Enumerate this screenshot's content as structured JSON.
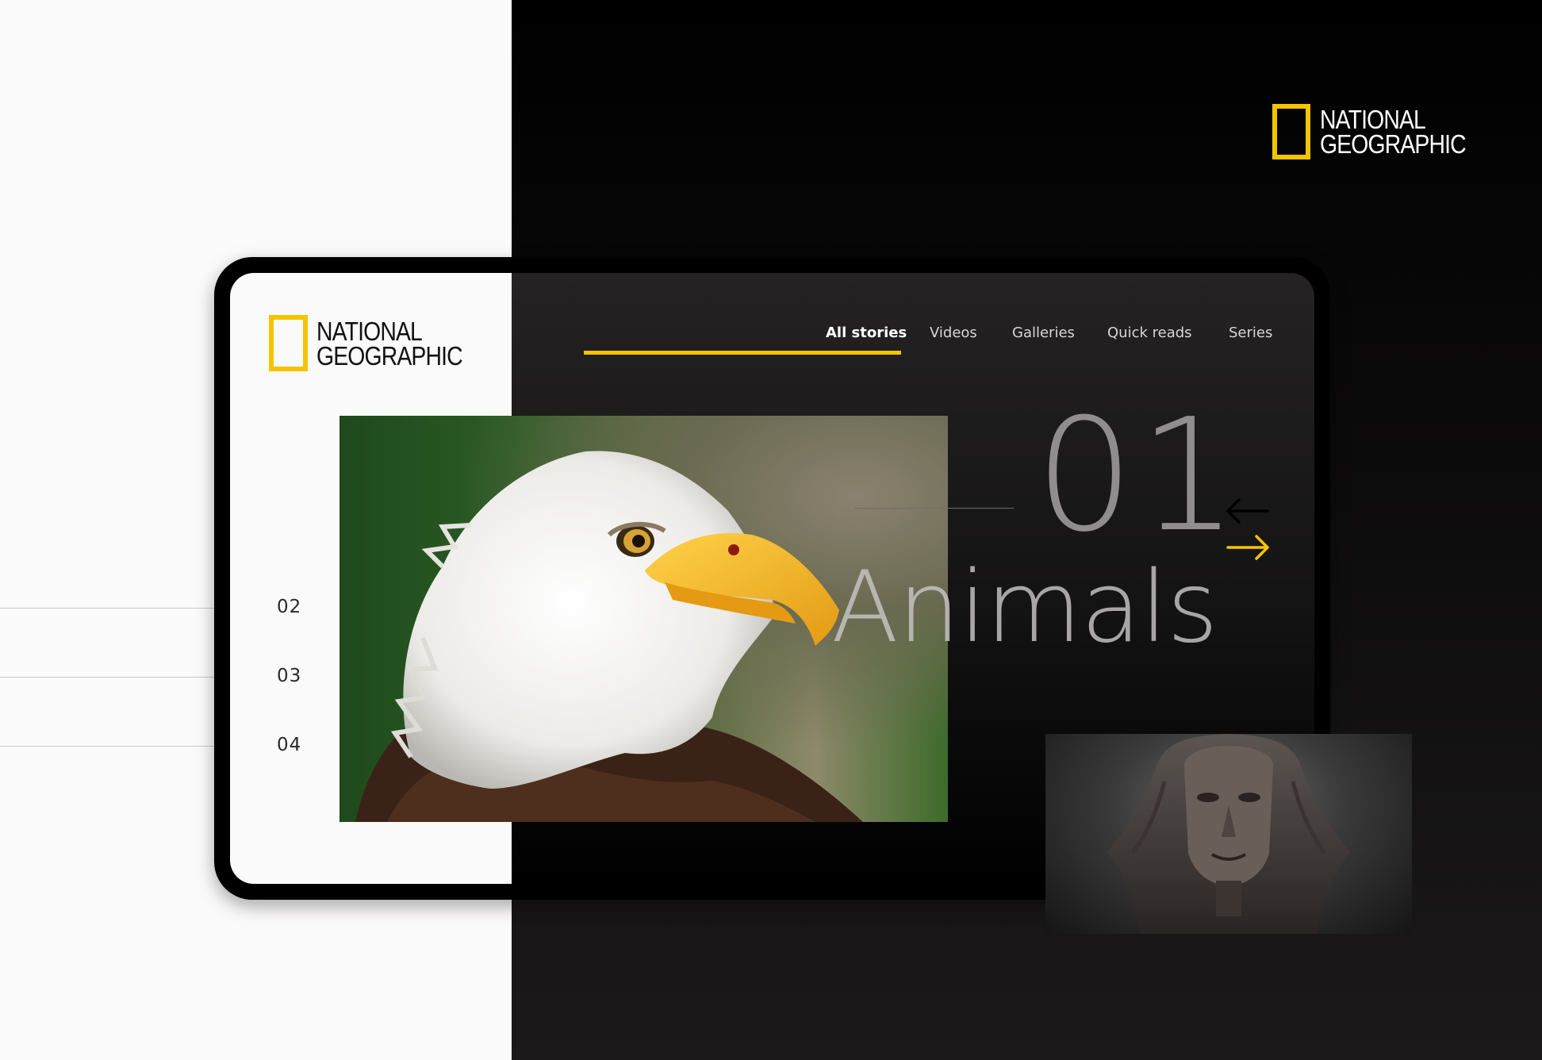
{
  "brand": {
    "line1": "NATIONAL",
    "line2": "GEOGRAPHIC",
    "accent_color": "#f5c400",
    "logo_icon": "yellow-rectangle-frame-icon"
  },
  "nav": {
    "items": [
      {
        "label": "All stories",
        "active": true
      },
      {
        "label": "Videos",
        "active": false
      },
      {
        "label": "Galleries",
        "active": false
      },
      {
        "label": "Quick reads",
        "active": false
      },
      {
        "label": "Series",
        "active": false
      }
    ]
  },
  "story": {
    "number": "01",
    "title": "Animals"
  },
  "side_index": [
    "02",
    "03",
    "04"
  ],
  "images": {
    "hero": "bald-eagle-photo",
    "next": "sphinx-statue-photo"
  },
  "icons": {
    "prev": "arrow-left-icon",
    "next": "arrow-right-icon"
  },
  "colors": {
    "dark_bg": "#0b0a0a",
    "light_bg": "#fcfbfb",
    "number_grey": "#8f8d8d"
  }
}
